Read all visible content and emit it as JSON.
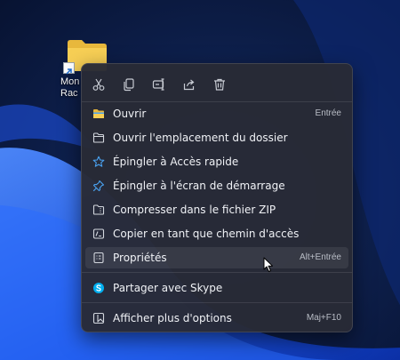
{
  "desktop": {
    "shortcut": {
      "label": "Mon\nRac"
    },
    "wallpaper_colors": {
      "base": "#0b1a3c",
      "bloom": "#1c55e8",
      "glow": "#4f8bff"
    }
  },
  "context_menu": {
    "action_bar": [
      {
        "name": "cut-icon",
        "label": "Couper"
      },
      {
        "name": "copy-icon",
        "label": "Copier"
      },
      {
        "name": "rename-icon",
        "label": "Renommer"
      },
      {
        "name": "share-icon",
        "label": "Partager"
      },
      {
        "name": "delete-icon",
        "label": "Supprimer"
      }
    ],
    "items": [
      {
        "label": "Ouvrir",
        "shortcut": "Entrée",
        "icon": "folder-color-icon"
      },
      {
        "label": "Ouvrir l'emplacement du dossier",
        "shortcut": "",
        "icon": "folder-outline-icon"
      },
      {
        "label": "Épingler à Accès rapide",
        "shortcut": "",
        "icon": "star-icon"
      },
      {
        "label": "Épingler à l'écran de démarrage",
        "shortcut": "",
        "icon": "pin-icon"
      },
      {
        "label": "Compresser dans le fichier ZIP",
        "shortcut": "",
        "icon": "zip-folder-icon"
      },
      {
        "label": "Copier en tant que chemin d'accès",
        "shortcut": "",
        "icon": "copy-path-icon"
      },
      {
        "label": "Propriétés",
        "shortcut": "Alt+Entrée",
        "icon": "properties-icon",
        "hovered": true
      }
    ],
    "extra_items": [
      {
        "label": "Partager avec Skype",
        "icon": "skype-icon"
      }
    ],
    "more_options": {
      "label": "Afficher plus d'options",
      "shortcut": "Maj+F10",
      "icon": "more-options-icon"
    }
  },
  "colors": {
    "menu_bg": "#282a36",
    "text": "#f0f2f6",
    "shortcut_text": "#b9bdc6",
    "accent": "#4aa3f2",
    "skype": "#00aff0"
  }
}
